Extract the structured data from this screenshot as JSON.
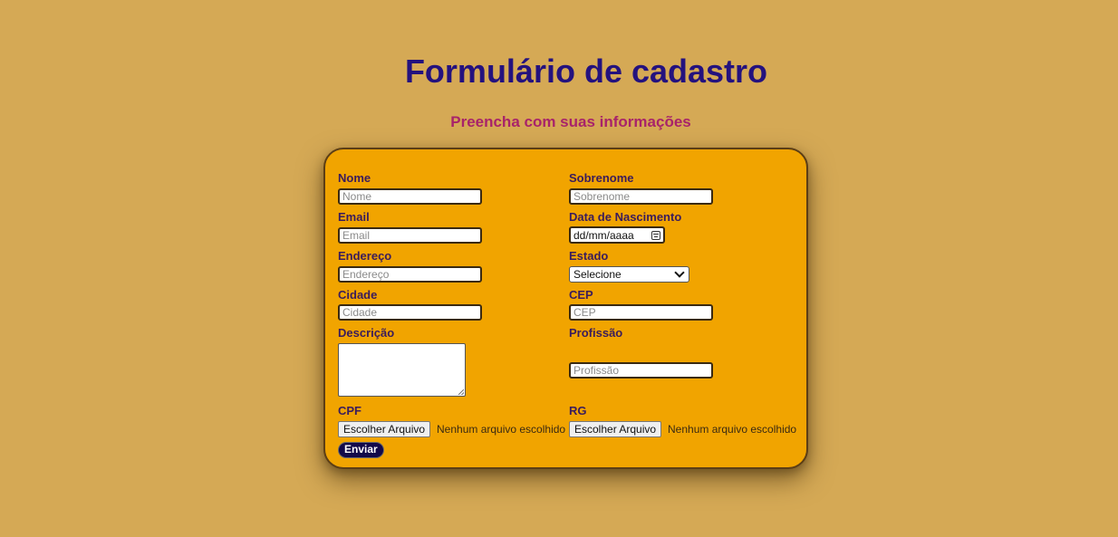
{
  "page": {
    "title": "Formulário de cadastro",
    "subtitle": "Preencha com suas informações"
  },
  "colors": {
    "background": "#d5a955",
    "card": "#f1a400",
    "title": "#24127e",
    "subtitle": "#a8236a",
    "label": "#3a1c5c",
    "submit_bg": "#12094a"
  },
  "form": {
    "nome": {
      "label": "Nome",
      "placeholder": "Nome",
      "value": ""
    },
    "sobrenome": {
      "label": "Sobrenome",
      "placeholder": "Sobrenome",
      "value": ""
    },
    "email": {
      "label": "Email",
      "placeholder": "Email",
      "value": ""
    },
    "nascimento": {
      "label": "Data de Nascimento",
      "value": "dd/mm/aaaa",
      "icon": "calendar-icon"
    },
    "endereco": {
      "label": "Endereço",
      "placeholder": "Endereço",
      "value": ""
    },
    "estado": {
      "label": "Estado",
      "selected": "Selecione",
      "icon": "chevron-down-icon"
    },
    "cidade": {
      "label": "Cidade",
      "placeholder": "Cidade",
      "value": ""
    },
    "cep": {
      "label": "CEP",
      "placeholder": "CEP",
      "value": ""
    },
    "descricao": {
      "label": "Descrição",
      "value": ""
    },
    "profissao": {
      "label": "Profissão",
      "placeholder": "Profissão",
      "value": ""
    },
    "cpf": {
      "label": "CPF",
      "button": "Escolher Arquivo",
      "status": "Nenhum arquivo escolhido"
    },
    "rg": {
      "label": "RG",
      "button": "Escolher Arquivo",
      "status": "Nenhum arquivo escolhido"
    },
    "submit_label": "Enviar"
  }
}
